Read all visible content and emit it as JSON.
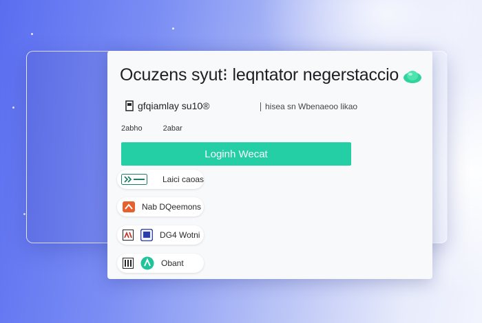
{
  "card": {
    "title": "Ocuzens syut⁝ leqntator negerstaccio",
    "sub_left": "gfqiamlay su10®",
    "sub_right": "hisea sn Wbenaeoo likao",
    "link_left": "2abho",
    "link_right": "2abar",
    "login_label": "Loginh Wecat"
  },
  "options": [
    {
      "label": "Laici caoas",
      "icon": "arrow-badge-icon"
    },
    {
      "label": "Nab DQeemons",
      "icon": "orange-app-icon"
    },
    {
      "label": "DG4 Wotni",
      "icon": "blue-square-icon"
    },
    {
      "label": "Obant",
      "icon": "teal-circle-icon"
    }
  ],
  "colors": {
    "accent": "#25cfa6",
    "card_bg": "#f8f9fb",
    "background_left": "#5a6df0",
    "background_right": "#f2f4fd"
  }
}
